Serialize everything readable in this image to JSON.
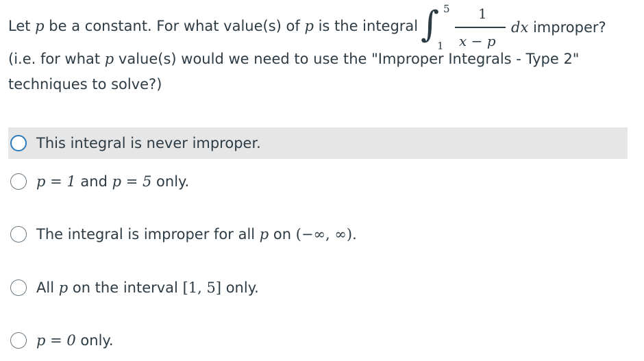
{
  "question": {
    "line1_before": "Let ",
    "var_p": "p",
    "line1_mid": " be a constant. For what value(s) of ",
    "line1_after": " is the integral",
    "integral": {
      "upper": "5",
      "lower": "1",
      "numerator": "1",
      "denominator": "x − p",
      "differential": "dx",
      "trailing": " improper?"
    },
    "line2": "(i.e. for what ",
    "line2_after": " value(s) would we need to use the \"Improper Integrals - Type 2\"",
    "line3": "techniques to solve?)"
  },
  "options": [
    {
      "id": "never",
      "text": "This integral is never improper.",
      "highlighted": true
    },
    {
      "id": "p1p5",
      "math": "p = 1",
      "text_mid": " and ",
      "math2": "p = 5",
      "text_end": " only."
    },
    {
      "id": "all",
      "text": "The integral is improper for all ",
      "var": "p",
      "text_mid": " on ",
      "math": "(−∞, ∞)."
    },
    {
      "id": "interval",
      "text": "All ",
      "var": "p",
      "text_mid": " on the interval ",
      "math": "[1, 5]",
      "text_end": " only."
    },
    {
      "id": "p0",
      "math": "p = 0",
      "text_end": " only."
    }
  ],
  "colors": {
    "text": "#2d3b45",
    "highlight": "#e6e6e6",
    "radio_selected_border": "#2b7abc"
  }
}
